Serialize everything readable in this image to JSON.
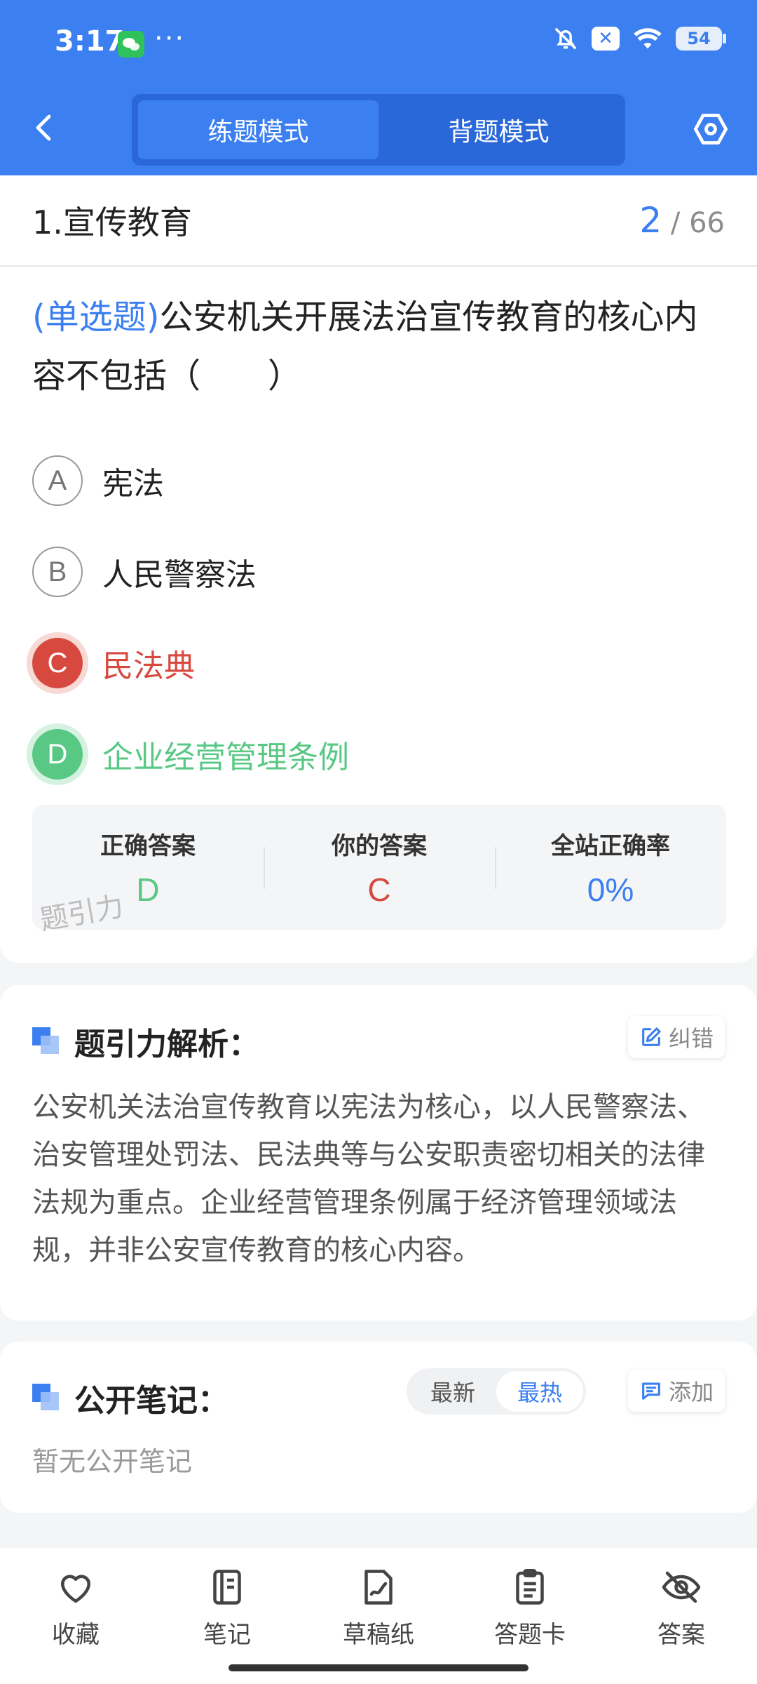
{
  "status_bar": {
    "time": "3:17",
    "dots": "···",
    "battery": "54"
  },
  "header": {
    "tabs": [
      {
        "label": "练题模式",
        "active": true
      },
      {
        "label": "背题模式",
        "active": false
      }
    ]
  },
  "question": {
    "section_title": "1.宣传教育",
    "current": "2",
    "total": "/ 66",
    "type": "(单选题)",
    "text": "公安机关开展法治宣传教育的核心内容不包括（　　）",
    "options": [
      {
        "letter": "A",
        "text": "宪法",
        "state": "normal"
      },
      {
        "letter": "B",
        "text": "人民警察法",
        "state": "normal"
      },
      {
        "letter": "C",
        "text": "民法典",
        "state": "wrong"
      },
      {
        "letter": "D",
        "text": "企业经营管理条例",
        "state": "correct"
      }
    ]
  },
  "answer_summary": {
    "correct_label": "正确答案",
    "correct_value": "D",
    "yours_label": "你的答案",
    "yours_value": "C",
    "rate_label": "全站正确率",
    "rate_value": "0%",
    "watermark": "题引力"
  },
  "analysis": {
    "title": "题引力解析：",
    "fix_label": "纠错",
    "text": "公安机关法治宣传教育以宪法为核心，以人民警察法、治安管理处罚法、民法典等与公安职责密切相关的法律法规为重点。企业经营管理条例属于经济管理领域法规，并非公安宣传教育的核心内容。"
  },
  "notes": {
    "title": "公开笔记：",
    "sort_options": [
      "最新",
      "最热"
    ],
    "sort_active": "最热",
    "add_label": "添加",
    "empty_text": "暂无公开笔记"
  },
  "bottom_nav": [
    {
      "label": "收藏",
      "icon": "heart-icon"
    },
    {
      "label": "笔记",
      "icon": "notebook-icon"
    },
    {
      "label": "草稿纸",
      "icon": "draft-paper-icon"
    },
    {
      "label": "答题卡",
      "icon": "answer-card-icon"
    },
    {
      "label": "答案",
      "icon": "eye-off-icon"
    }
  ],
  "colors": {
    "primary": "#3b7ff0",
    "correct": "#58c884",
    "wrong": "#d7493f"
  }
}
